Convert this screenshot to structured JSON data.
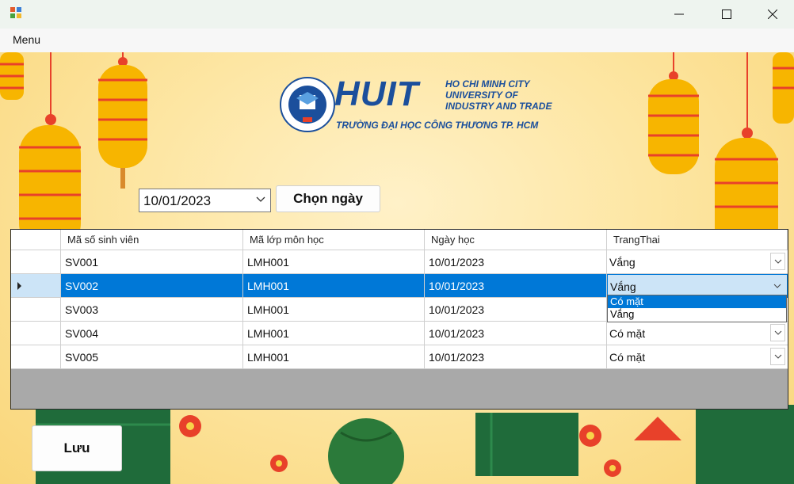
{
  "window": {
    "minimize_icon": "minimize-icon",
    "maximize_icon": "maximize-icon",
    "close_icon": "close-icon"
  },
  "menubar": {
    "menu_label": "Menu"
  },
  "logo": {
    "acronym": "HUIT",
    "line1": "HO CHI MINH CITY",
    "line2": "UNIVERSITY OF",
    "line3": "INDUSTRY AND TRADE",
    "line4": "TRƯỜNG ĐẠI HỌC CÔNG THƯƠNG TP. HCM",
    "color": "#1b4f9c"
  },
  "date_picker": {
    "value": "10/01/2023"
  },
  "choose_button": {
    "label": "Chọn ngày"
  },
  "save_button": {
    "label": "Lưu"
  },
  "grid": {
    "columns": [
      "Mã số sinh viên",
      "Mã lớp môn học",
      "Ngày học",
      "TrangThai"
    ],
    "rows": [
      {
        "student_id": "SV001",
        "class_id": "LMH001",
        "date": "10/01/2023",
        "status": "Vắng"
      },
      {
        "student_id": "SV002",
        "class_id": "LMH001",
        "date": "10/01/2023",
        "status": "Vắng"
      },
      {
        "student_id": "SV003",
        "class_id": "LMH001",
        "date": "10/01/2023",
        "status": ""
      },
      {
        "student_id": "SV004",
        "class_id": "LMH001",
        "date": "10/01/2023",
        "status": "Có mặt"
      },
      {
        "student_id": "SV005",
        "class_id": "LMH001",
        "date": "10/01/2023",
        "status": "Có mặt"
      }
    ],
    "selected_row": 2,
    "status_options": [
      "Có mặt",
      "Vắng"
    ],
    "highlighted_option": "Có mặt"
  },
  "colors": {
    "selection": "#0078d7",
    "lantern": "#f7b500",
    "lantern_stripe": "#e8412a",
    "grid_bg": "#a9a9a9"
  }
}
